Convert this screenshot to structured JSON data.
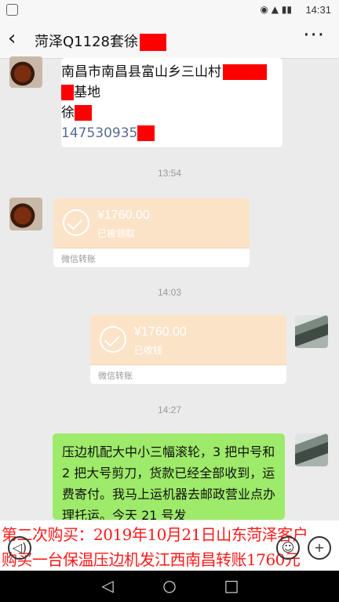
{
  "status_bar": {
    "time": "14:31"
  },
  "header": {
    "title": "菏泽Q1128套徐"
  },
  "messages": {
    "address": {
      "line1": "南昌市南昌县富山乡三山村",
      "line2": "基地",
      "line3": "徐",
      "phone": "147530935"
    },
    "ts1": "13:54",
    "transfer1": {
      "amount": "¥1760.00",
      "status": "已被领取",
      "label": "微信转账"
    },
    "ts2": "14:03",
    "transfer2": {
      "amount": "¥1760.00",
      "status": "已收钱",
      "label": "微信转账"
    },
    "ts3": "14:27",
    "text_msg": "压边机配大中小三幅滚轮，3 把中号和 2 把大号剪刀，货款已经全部收到，运费寄付。我马上运机器去邮政营业点办理托运。今天 21 号发"
  },
  "overlay": {
    "line1": "第二次购买：2019年10月21日山东菏泽客户",
    "line2": "购买一台保温压边机发江西南昌转账1760元"
  },
  "colors": {
    "accent_green": "#9eea6a",
    "transfer_bg": "#fbe3c8",
    "redaction": "#ff0000",
    "overlay_text": "#ff1a1a"
  }
}
